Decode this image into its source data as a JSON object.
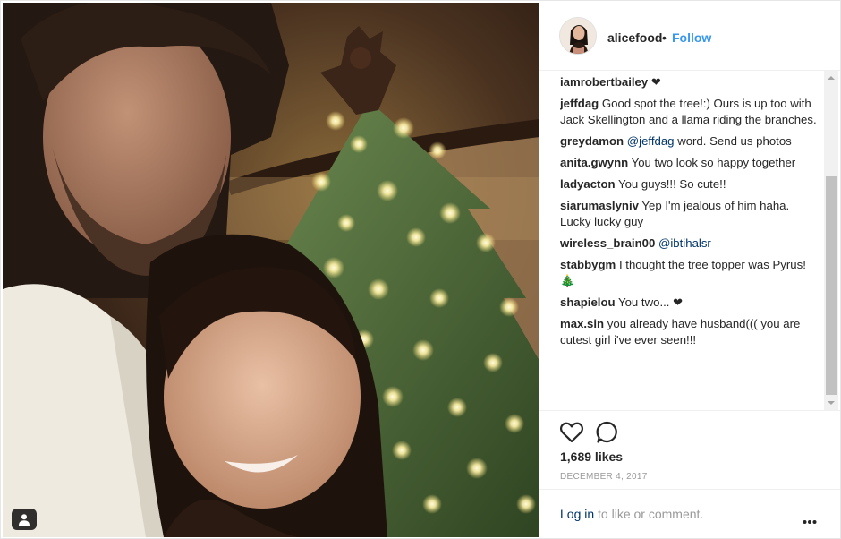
{
  "post": {
    "photo": {
      "description_icon": "user-tag-icon"
    },
    "author": {
      "username": "alicefood",
      "separator": "•",
      "follow_label": "Follow"
    },
    "comments": [
      {
        "user": "iamrobertbailey",
        "text": "❤"
      },
      {
        "user": "jeffdag",
        "text": "Good spot the tree!:) Ours is up too with Jack Skellington and a llama riding the branches."
      },
      {
        "user": "greydamon",
        "mention": "@jeffdag",
        "text": "word. Send us photos"
      },
      {
        "user": "anita.gwynn",
        "text": "You two look so happy together"
      },
      {
        "user": "ladyacton",
        "text": "You guys!!! So cute!!"
      },
      {
        "user": "siarumaslyniv",
        "text": "Yep I'm jealous of him haha. Lucky lucky guy"
      },
      {
        "user": "wireless_brain00",
        "mention": "@ibtihalsr",
        "text": ""
      },
      {
        "user": "stabbygm",
        "text": "I thought the tree topper was Pyrus! 🎄"
      },
      {
        "user": "shapielou",
        "text": "You two... ❤"
      },
      {
        "user": "max.sin",
        "text": "you already have husband((( you are cutest girl i've ever seen!!!"
      }
    ],
    "likes": "1,689 likes",
    "date": "DECEMBER 4, 2017",
    "footer": {
      "login_link": "Log in",
      "login_rest": "to like or comment."
    },
    "icons": {
      "like": "heart-icon",
      "comment": "comment-icon",
      "more": "more-options-icon"
    },
    "colors": {
      "link_blue": "#3897f0",
      "username_text": "#262626",
      "mention": "#003569",
      "muted": "#999999"
    }
  }
}
